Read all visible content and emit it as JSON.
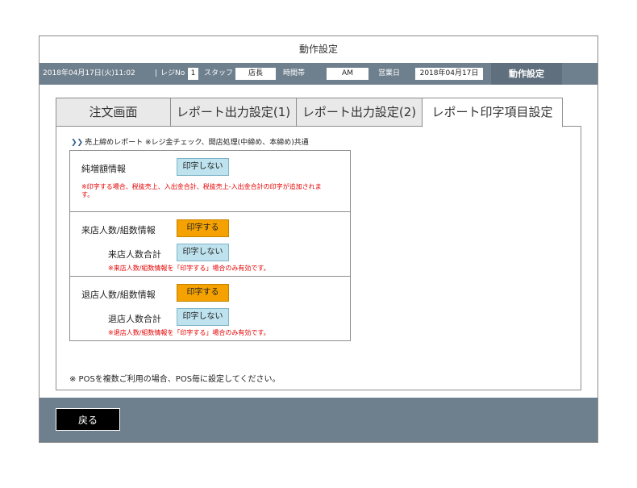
{
  "window": {
    "title": "動作設定"
  },
  "statusbar": {
    "datetime": "2018年04月17日(火)11:02",
    "register_label": "レジNo",
    "register_value": "1",
    "staff_label": "スタッフ",
    "staff_value": "店長",
    "timeslot_label": "時間帯",
    "timeslot_value": "AM",
    "bizday_label": "営業日",
    "bizday_value": "2018年04月17日",
    "mode": "動作設定"
  },
  "tabs": [
    {
      "label": "注文画面"
    },
    {
      "label": "レポート出力設定(1)"
    },
    {
      "label": "レポート出力設定(2)"
    },
    {
      "label": "レポート印字項目設定"
    }
  ],
  "panel": {
    "heading": "売上締めレポート ※レジ金チェック、開店処理(中締め、本締め)共通",
    "groups": [
      {
        "label": "純増額情報",
        "button": "印字しない",
        "note": "※印字する場合、税抜売上、入出金合計、税抜売上-入出金合計の印字が追加されます。"
      },
      {
        "label": "来店人数/組数情報",
        "button": "印字する",
        "sub_label": "来店人数合計",
        "sub_button": "印字しない",
        "note": "※来店人数/組数情報を「印字する」場合のみ有効です。"
      },
      {
        "label": "退店人数/組数情報",
        "button": "印字する",
        "sub_label": "退店人数合計",
        "sub_button": "印字しない",
        "note": "※退店人数/組数情報を「印字する」場合のみ有効です。"
      }
    ],
    "footnote": "※ POSを複数ご利用の場合、POS毎に設定してください。"
  },
  "footer": {
    "back_label": "戻る"
  },
  "colors": {
    "bar": "#6e7f8d",
    "button_off": "#bfe3ee",
    "button_on": "#f5a200",
    "note_red": "#e60000"
  },
  "icons": {
    "heading_marker": "double-chevron-right-icon"
  }
}
